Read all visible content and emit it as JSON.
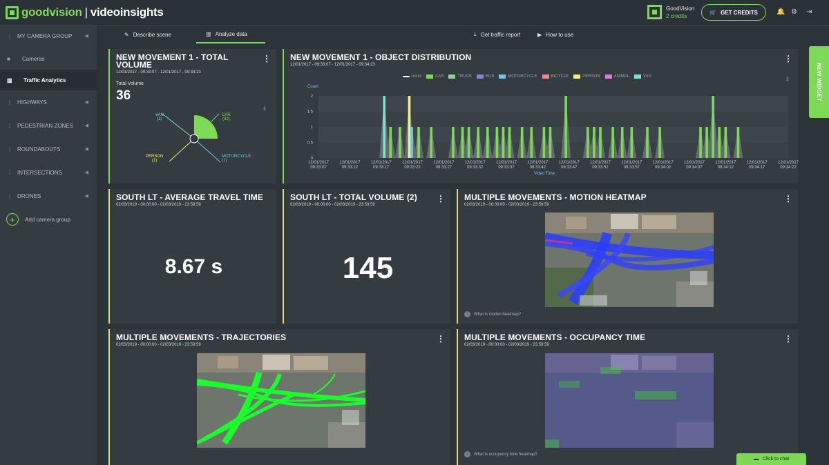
{
  "app": {
    "logo_part1": "goodvision",
    "logo_sep": "|",
    "logo_part2": "videoinsights"
  },
  "account": {
    "name": "GoodVision",
    "credits": "2  credits",
    "get_credits_label": "GET CREDITS"
  },
  "top_icons": [
    "bell-icon",
    "gear-icon",
    "logout-icon"
  ],
  "tabs": [
    {
      "label": "Describe scene",
      "icon": "pencil-icon",
      "active": false
    },
    {
      "label": "Analyze data",
      "icon": "chart-icon",
      "active": true
    },
    {
      "label": "Get traffic report",
      "icon": "download-icon",
      "active": false
    },
    {
      "label": "How to use",
      "icon": "play-icon",
      "active": false
    }
  ],
  "sidebar": {
    "group_title": "MY CAMERA GROUP",
    "items": [
      {
        "label": "Cameras",
        "icon": "camera-icon"
      },
      {
        "label": "Traffic Analytics",
        "icon": "bar-chart-icon"
      }
    ],
    "groups": [
      "HIGHWAYS",
      "PEDESTRIAN ZONES",
      "ROUNDABOUTS",
      "INTERSECTIONS",
      "DRONES"
    ],
    "add_label": "Add camera group"
  },
  "new_widget_label": "NEW WIDGET",
  "chat_label": "Click to chat",
  "colors": {
    "accent": "#7ed957",
    "yellow_border": "#e8d882",
    "panel": "#343b41"
  },
  "widgets": {
    "total_volume": {
      "title": "NEW MOVEMENT 1 - TOTAL VOLUME",
      "date": "12/01/2017 - 09:33:07 - 12/01/2017 - 09:34:23",
      "label": "Total Volume",
      "value": "36",
      "pie_labels": [
        {
          "name": "VAN",
          "count": "(2)",
          "color": "#7ee0d0"
        },
        {
          "name": "CAR",
          "count": "(32)",
          "color": "#7ed957"
        },
        {
          "name": "PERSON",
          "count": "(1)",
          "color": "#f5f07a"
        },
        {
          "name": "MOTORCYCLE",
          "count": "(1)",
          "color": "#6ec6e8"
        }
      ]
    },
    "distribution": {
      "title": "NEW MOVEMENT 1 - OBJECT DISTRIBUTION",
      "date": "12/01/2017 - 09:33:07 - 12/01/2017 - 09:34:23"
    },
    "avg_travel": {
      "title": "SOUTH LT - AVERAGE TRAVEL TIME",
      "date": "02/03/2019 - 00:00:00 - 02/03/2019 - 23:59:59",
      "value": "8.67 s"
    },
    "south_volume": {
      "title": "SOUTH LT - TOTAL VOLUME (2)",
      "date": "02/03/2019 - 00:00:00 - 02/03/2019 - 23:59:59",
      "value": "145"
    },
    "heatmap": {
      "title": "MULTIPLE MOVEMENTS - MOTION HEATMAP",
      "date": "02/03/2019 - 00:00:00 - 02/03/2019 - 23:59:59",
      "help": "What is motion heatmap?"
    },
    "trajectories": {
      "title": "MULTIPLE MOVEMENTS - TRAJECTORIES",
      "date": "02/03/2019 - 00:00:00 - 02/03/2019 - 23:59:59"
    },
    "occupancy": {
      "title": "MULTIPLE MOVEMENTS - OCCUPANCY TIME",
      "date": "02/03/2019 - 00:00:00 - 02/03/2019 - 23:59:59",
      "help": "What is occupancy time heatmap?"
    }
  },
  "chart_data": {
    "type": "bar",
    "ylabel": "Count",
    "xlabel": "Video Time",
    "ylim": [
      0,
      2
    ],
    "yticks": [
      "2",
      "1.5",
      "1",
      "0.5",
      "0"
    ],
    "legend": [
      {
        "name": "trend",
        "color": "#ffffff"
      },
      {
        "name": "CAR",
        "color": "#7ed957"
      },
      {
        "name": "TRUCK",
        "color": "#8fd18f"
      },
      {
        "name": "BUS",
        "color": "#8a80e8"
      },
      {
        "name": "MOTORCYCLE",
        "color": "#6ec6e8"
      },
      {
        "name": "BICYCLE",
        "color": "#f08a8a"
      },
      {
        "name": "PERSON",
        "color": "#f5f07a"
      },
      {
        "name": "ANIMAL",
        "color": "#e07ae0"
      },
      {
        "name": "VAN",
        "color": "#7ee0d0"
      }
    ],
    "x_ticks": [
      "12/01/2017\n09:33:07",
      "12/01/2017\n09:33:12",
      "12/01/2017\n09:33:17",
      "12/01/2017\n09:33:22",
      "12/01/2017\n09:33:27",
      "12/01/2017\n09:33:32",
      "12/01/2017\n09:33:37",
      "12/01/2017\n09:33:42",
      "12/01/2017\n09:33:47",
      "12/01/2017\n09:33:52",
      "12/01/2017\n09:33:57",
      "12/01/2017\n09:34:02",
      "12/01/2017\n09:34:07",
      "12/01/2017\n09:34:12",
      "12/01/2017\n09:34:17",
      "12/01/2017\n09:34:22"
    ],
    "bars": [
      {
        "t": 17.5,
        "v": 2,
        "s": "VAN"
      },
      {
        "t": 18.5,
        "v": 1,
        "s": "CAR"
      },
      {
        "t": 20,
        "v": 1,
        "s": "CAR"
      },
      {
        "t": 21.5,
        "v": 2,
        "s": "PERSON"
      },
      {
        "t": 21.9,
        "v": 1,
        "s": "MOTORCYCLE"
      },
      {
        "t": 23,
        "v": 1,
        "s": "CAR"
      },
      {
        "t": 25,
        "v": 1,
        "s": "CAR"
      },
      {
        "t": 28.5,
        "v": 1,
        "s": "CAR"
      },
      {
        "t": 30,
        "v": 1,
        "s": "CAR"
      },
      {
        "t": 31,
        "v": 1,
        "s": "CAR"
      },
      {
        "t": 32.5,
        "v": 1,
        "s": "CAR"
      },
      {
        "t": 34,
        "v": 1,
        "s": "CAR"
      },
      {
        "t": 35.5,
        "v": 1,
        "s": "CAR"
      },
      {
        "t": 36.5,
        "v": 1,
        "s": "CAR"
      },
      {
        "t": 37.5,
        "v": 1,
        "s": "CAR"
      },
      {
        "t": 39.5,
        "v": 1,
        "s": "CAR"
      },
      {
        "t": 41,
        "v": 1,
        "s": "CAR"
      },
      {
        "t": 43,
        "v": 1,
        "s": "CAR"
      },
      {
        "t": 44,
        "v": 1,
        "s": "CAR"
      },
      {
        "t": 46.5,
        "v": 2,
        "s": "CAR"
      },
      {
        "t": 50,
        "v": 1,
        "s": "CAR"
      },
      {
        "t": 51,
        "v": 1,
        "s": "CAR"
      },
      {
        "t": 52,
        "v": 1,
        "s": "CAR"
      },
      {
        "t": 54,
        "v": 1,
        "s": "CAR"
      },
      {
        "t": 55.5,
        "v": 1,
        "s": "CAR"
      },
      {
        "t": 57,
        "v": 1,
        "s": "CAR"
      },
      {
        "t": 59.5,
        "v": 1,
        "s": "CAR"
      },
      {
        "t": 61.5,
        "v": 1,
        "s": "CAR"
      },
      {
        "t": 68,
        "v": 1,
        "s": "CAR"
      },
      {
        "t": 69,
        "v": 1,
        "s": "CAR"
      },
      {
        "t": 70,
        "v": 2,
        "s": "CAR"
      },
      {
        "t": 71,
        "v": 1,
        "s": "CAR"
      },
      {
        "t": 72,
        "v": 1,
        "s": "CAR"
      },
      {
        "t": 74,
        "v": 1,
        "s": "CAR"
      }
    ]
  }
}
